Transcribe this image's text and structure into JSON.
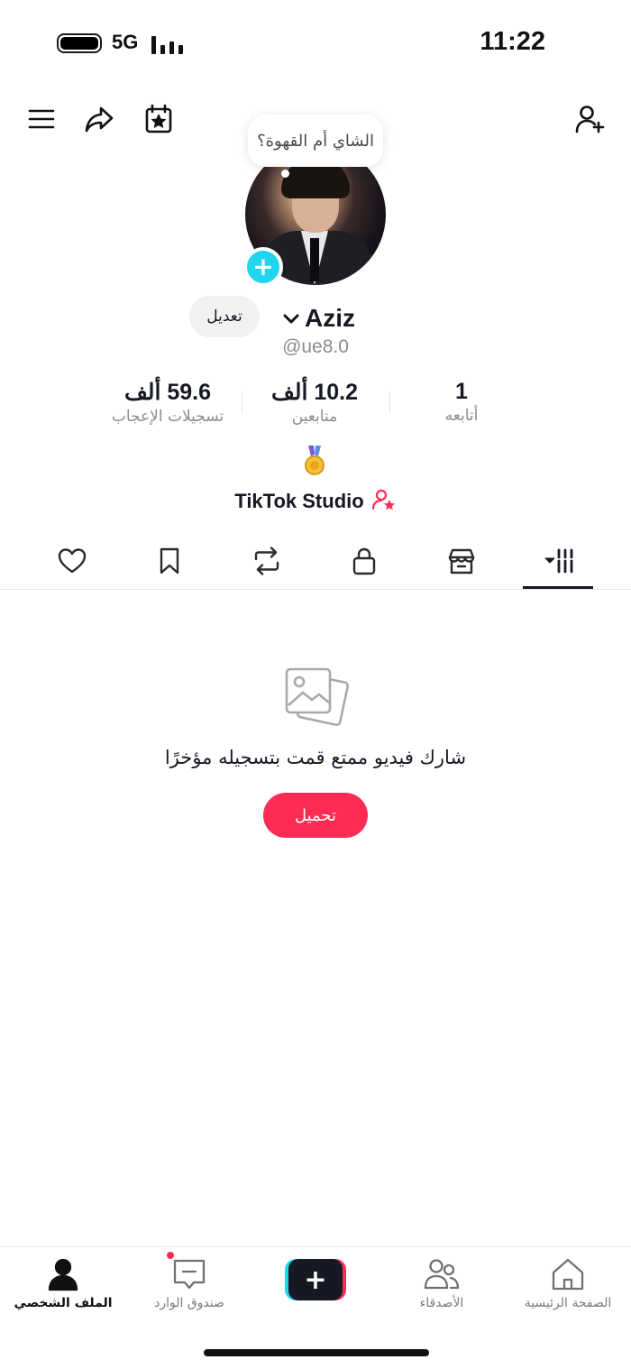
{
  "status_bar": {
    "network": "5G",
    "time": "11:22"
  },
  "profile": {
    "note": "الشاي أم القهوة؟",
    "edit_label": "تعديل",
    "username": "Aziz",
    "handle": "@ue8.0",
    "studio_label": "TikTok Studio"
  },
  "stats": {
    "likes": {
      "value": "59.6 ألف",
      "label": "تسجيلات الإعجاب"
    },
    "followers": {
      "value": "10.2 ألف",
      "label": "متابعين"
    },
    "following": {
      "value": "1",
      "label": "أتابعه"
    }
  },
  "tabs": [
    {
      "icon": "heart-icon"
    },
    {
      "icon": "bookmark-icon"
    },
    {
      "icon": "repost-icon"
    },
    {
      "icon": "lock-icon"
    },
    {
      "icon": "shop-icon"
    },
    {
      "icon": "grid-icon",
      "active": true
    }
  ],
  "empty_state": {
    "message": "شارك فيديو ممتع قمت بتسجيله مؤخرًا",
    "upload_label": "تحميل"
  },
  "bottom_nav": {
    "profile": "الملف الشخصي",
    "inbox": "صندوق الوارد",
    "friends": "الأصدقاء",
    "home": "الصفحة الرئيسية"
  },
  "colors": {
    "accent": "#fe2c55",
    "cyan": "#20d5ec",
    "text": "#161823",
    "muted": "#8a8b91"
  }
}
